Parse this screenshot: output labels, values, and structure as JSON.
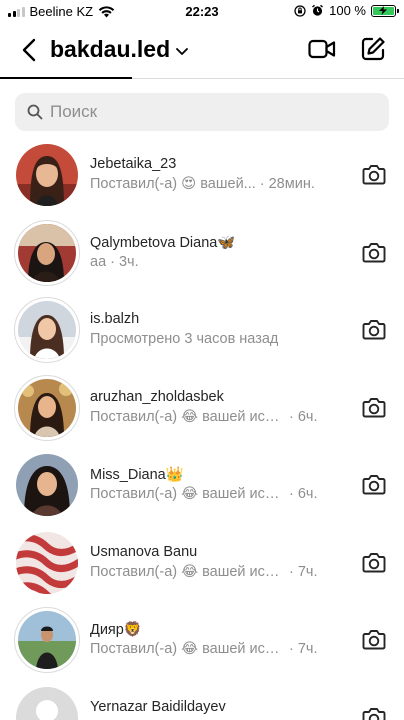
{
  "status_bar": {
    "carrier": "Beeline KZ",
    "time": "22:23",
    "battery": "100 %",
    "battery_level": 1.0
  },
  "header": {
    "title": "bakdau.led",
    "icons": [
      "back-icon",
      "chevron-down-icon",
      "video-call-icon",
      "compose-icon"
    ]
  },
  "search": {
    "placeholder": "Поиск"
  },
  "conversations": [
    {
      "name": "Jebetaika_23",
      "preview": "Поставил(-а) 😍 вашей...",
      "time": "· 28мин."
    },
    {
      "name": "Qalymbetova Diana🦋",
      "preview": "аа",
      "time": "· 3ч."
    },
    {
      "name": "is.balzh",
      "preview": "Просмотрено 3 часов назад",
      "time": ""
    },
    {
      "name": "aruzhan_zholdasbek",
      "preview": "Поставил(-а) 😂 вашей исто...",
      "time": "· 6ч."
    },
    {
      "name": "Miss_Diana👑",
      "preview": "Поставил(-а) 😂 вашей исто...",
      "time": "· 6ч."
    },
    {
      "name": "Usmanova Banu",
      "preview": "Поставил(-а) 😂 вашей исто...",
      "time": "· 7ч."
    },
    {
      "name": "Дияр🦁",
      "preview": "Поставил(-а) 😂 вашей исто...",
      "time": "· 7ч."
    },
    {
      "name": "Yernazar Baidildayev",
      "preview": "",
      "time": ""
    }
  ],
  "colors": {
    "text_primary": "#262626",
    "text_secondary": "#8e8e8e",
    "search_bg": "#efefef",
    "divider": "#dbdbdb",
    "battery_green": "#34c759"
  }
}
